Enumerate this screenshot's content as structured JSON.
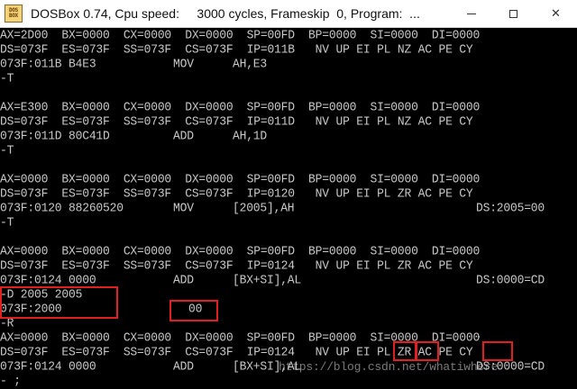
{
  "window": {
    "title": "DOSBox 0.74, Cpu speed:     3000 cycles, Frameskip  0, Program:  ...",
    "icon_name": "dosbox-icon",
    "icon_text": [
      "DOS",
      "BOX"
    ],
    "minimize_icon": "minimize-icon",
    "maximize_icon": "maximize-icon",
    "close_icon": "close-icon",
    "close_symbol": "✕"
  },
  "console": {
    "lines": [
      {
        "name": "regs-ax-1",
        "text": "AX=2D00  BX=0000  CX=0000  DX=0000  SP=00FD  BP=0000  SI=0000  DI=0000"
      },
      {
        "name": "regs-ds-1",
        "text": "DS=073F  ES=073F  SS=073F  CS=073F  IP=011B   NV UP EI PL NZ AC PE CY"
      },
      {
        "name": "instr-1",
        "addr": "073F:011B B4E3",
        "mnem": "MOV",
        "ops": "AH,E3",
        "extra": ""
      },
      {
        "name": "prompt-t-1",
        "text": "-T"
      },
      {
        "name": "regs-ax-2",
        "text": "AX=E300  BX=0000  CX=0000  DX=0000  SP=00FD  BP=0000  SI=0000  DI=0000"
      },
      {
        "name": "regs-ds-2",
        "text": "DS=073F  ES=073F  SS=073F  CS=073F  IP=011D   NV UP EI PL NZ AC PE CY"
      },
      {
        "name": "instr-2",
        "addr": "073F:011D 80C41D",
        "mnem": "ADD",
        "ops": "AH,1D",
        "extra": ""
      },
      {
        "name": "prompt-t-2",
        "text": "-T"
      },
      {
        "name": "regs-ax-3",
        "text": "AX=0000  BX=0000  CX=0000  DX=0000  SP=00FD  BP=0000  SI=0000  DI=0000"
      },
      {
        "name": "regs-ds-3",
        "text": "DS=073F  ES=073F  SS=073F  CS=073F  IP=0120   NV UP EI PL ZR AC PE CY"
      },
      {
        "name": "instr-3",
        "addr": "073F:0120 88260520",
        "mnem": "MOV",
        "ops": "[2005],AH",
        "extra": "DS:2005=00"
      },
      {
        "name": "prompt-t-3",
        "text": "-T"
      },
      {
        "name": "regs-ax-4",
        "text": "AX=0000  BX=0000  CX=0000  DX=0000  SP=00FD  BP=0000  SI=0000  DI=0000"
      },
      {
        "name": "regs-ds-4",
        "text": "DS=073F  ES=073F  SS=073F  CS=073F  IP=0124   NV UP EI PL ZR AC PE CY"
      },
      {
        "name": "instr-4",
        "addr": "073F:0124 0000",
        "mnem": "ADD",
        "ops": "[BX+SI],AL",
        "extra": "DS:0000=CD"
      },
      {
        "name": "dump-command",
        "text": "-D 2005 2005"
      },
      {
        "name": "dump-output",
        "addr": "073F:2000",
        "value": "00"
      },
      {
        "name": "prompt-r",
        "text": "-R"
      },
      {
        "name": "regs-ax-5",
        "text": "AX=0000  BX=0000  CX=0000  DX=0000  SP=00FD  BP=0000  SI=0000  DI=0000"
      },
      {
        "name": "regs-ds-5",
        "text": "DS=073F  ES=073F  SS=073F  CS=073F  IP=0124   NV UP EI PL ZR AC PE CY"
      },
      {
        "name": "instr-5",
        "addr": "073F:0124 0000",
        "mnem": "ADD",
        "ops": "[BX+SI],AL",
        "extra": "DS:0000=CD"
      },
      {
        "name": "prompt-cursor",
        "text": "- ;"
      }
    ]
  },
  "watermark": "https://blog.csdn.net/whatiwhere",
  "colors": {
    "console_text": "#c8c8c8",
    "console_bg": "#000000",
    "highlight_box": "#e02020",
    "titlebar_bg": "#ffffff"
  }
}
